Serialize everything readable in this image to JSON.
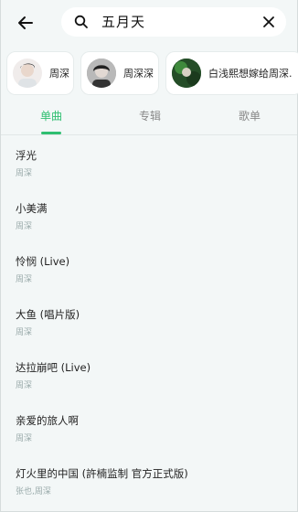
{
  "search": {
    "query": "五月天"
  },
  "artists": [
    {
      "name": "周深"
    },
    {
      "name": "周深深"
    },
    {
      "name": "白浅熙想嫁给周深."
    }
  ],
  "tabs": [
    {
      "label": "单曲"
    },
    {
      "label": "专辑"
    },
    {
      "label": "歌单"
    }
  ],
  "songs": [
    {
      "title": "浮光",
      "artist": "周深"
    },
    {
      "title": "小美满",
      "artist": "周深"
    },
    {
      "title": "怜悯 (Live)",
      "artist": "周深"
    },
    {
      "title": "大鱼 (唱片版)",
      "artist": "周深"
    },
    {
      "title": "达拉崩吧 (Live)",
      "artist": "周深"
    },
    {
      "title": "亲爱的旅人啊",
      "artist": "周深"
    },
    {
      "title": "灯火里的中国 (許楠监制 官方正式版)",
      "artist": "张也,周深"
    }
  ],
  "colors": {
    "accent": "#2fbf71",
    "background": "#f3f7f7"
  }
}
